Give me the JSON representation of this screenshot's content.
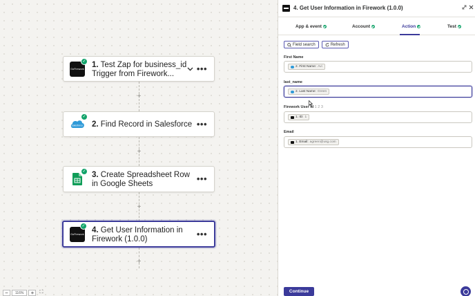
{
  "canvas": {
    "steps": [
      {
        "number": "1.",
        "title": "Test Zap for business_id Trigger from Firework...",
        "icon": "firework-icon",
        "icon_text": "GoFirework"
      },
      {
        "number": "2.",
        "title": "Find Record in Salesforce",
        "icon": "salesforce-icon",
        "icon_text": "salesforce"
      },
      {
        "number": "3.",
        "title": "Create Spreadsheet Row in Google Sheets",
        "icon": "google-sheets-icon"
      },
      {
        "number": "4.",
        "title": "Get User Information in Firework (1.0.0)",
        "icon": "firework-icon",
        "icon_text": "GoFirework"
      }
    ],
    "plus_symbol": "+",
    "more_symbol": "•••",
    "zoom": {
      "minus": "−",
      "value": "116%",
      "plus": "+",
      "fit": "⛶"
    }
  },
  "panel": {
    "title": "4. Get User Information in Firework (1.0.0)",
    "tabs": [
      {
        "label": "App & event"
      },
      {
        "label": "Account"
      },
      {
        "label": "Action"
      },
      {
        "label": "Test"
      }
    ],
    "tools": {
      "field_search": "Field search",
      "refresh": "Refresh"
    },
    "fields": [
      {
        "label": "First Name",
        "pill_label": "2. First Name:",
        "pill_value": "Avi",
        "source": "salesforce"
      },
      {
        "label": "last_name",
        "pill_label": "2. Last Name:",
        "pill_value": "Green",
        "source": "salesforce"
      },
      {
        "label": "Firework User id",
        "label_suffix": "1 2 3",
        "pill_label": "1. ID:",
        "pill_value": "1",
        "source": "firework"
      },
      {
        "label": "Email",
        "pill_label": "1. Email:",
        "pill_value": "agreen@usg.com",
        "source": "firework"
      }
    ],
    "continue_label": "Continue"
  },
  "colors": {
    "accent": "#3b3a9a",
    "success": "#12a36a",
    "salesforce": "#2f9ad8",
    "sheets": "#0f9d58"
  }
}
